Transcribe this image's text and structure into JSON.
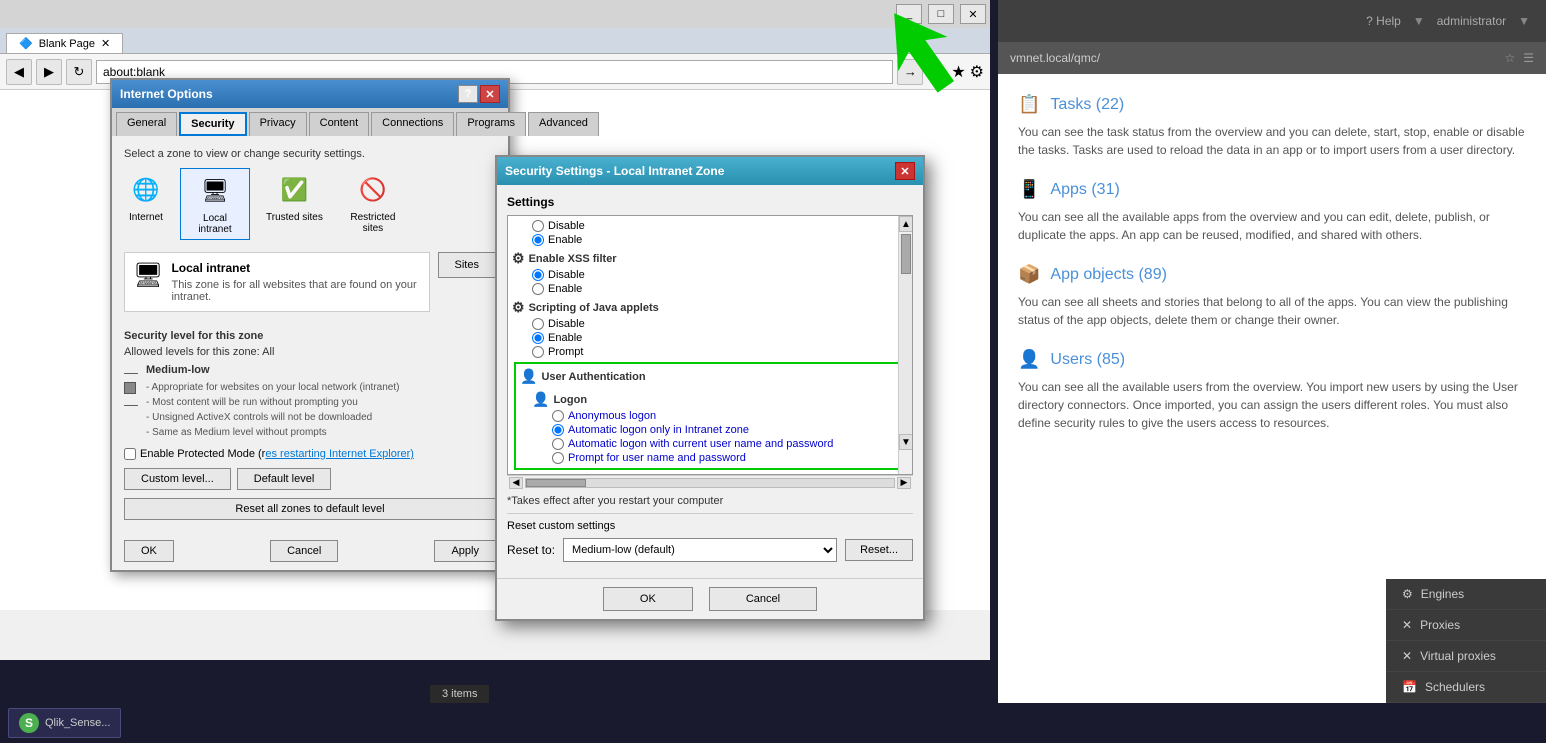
{
  "browser": {
    "title": "Blank Page",
    "title_buttons": [
      "_",
      "□",
      "✕"
    ],
    "address": "about:blank",
    "tab_label": "Blank Page",
    "nav_back": "◀",
    "nav_forward": "▶",
    "nav_refresh": "↻",
    "toolbar_icons": [
      "🏠",
      "★",
      "⚙"
    ]
  },
  "qmc": {
    "url": "vmnet.local/qmc/",
    "help_label": "? Help",
    "user_label": "administrator",
    "sections": [
      {
        "id": "tasks",
        "icon": "📋",
        "title": "Tasks (22)",
        "text": "You can see the task status from the overview and you can delete, start, stop, enable or disable the tasks. Tasks are used to reload the data in an app or to import users from a user directory."
      },
      {
        "id": "apps",
        "icon": "📱",
        "title": "Apps (31)",
        "text": "You can see all the available apps from the overview and you can edit, delete, publish, or duplicate the apps. An app can be reused, modified, and shared with others."
      },
      {
        "id": "app-objects",
        "icon": "📦",
        "title": "App objects (89)",
        "text": "You can see all sheets and stories that belong to all of the apps. You can view the publishing status of the app objects, delete them or change their owner."
      },
      {
        "id": "users",
        "icon": "👤",
        "title": "Users (85)",
        "text": "You can see all the available users from the overview. You import new users by using the User directory connectors. Once imported, you can assign the users different roles. You must also define security rules to give the users access to resources."
      }
    ],
    "sidebar_items": [
      "Engines",
      "Proxies",
      "Virtual proxies",
      "Schedulers"
    ]
  },
  "internet_options": {
    "title": "Internet Options",
    "title_btn_help": "?",
    "title_btn_close": "✕",
    "tabs": [
      "General",
      "Security",
      "Privacy",
      "Content",
      "Connections",
      "Programs",
      "Advanced"
    ],
    "active_tab": "Security",
    "zone_select_label": "Select a zone to view or change security settings.",
    "zones": [
      {
        "id": "internet",
        "label": "Internet",
        "icon": "🌐"
      },
      {
        "id": "local-intranet",
        "label": "Local intranet",
        "icon": "🖥",
        "selected": true
      },
      {
        "id": "trusted-sites",
        "label": "Trusted sites",
        "icon": "✅"
      },
      {
        "id": "restricted-sites",
        "label": "Restricted sites",
        "icon": "🚫"
      }
    ],
    "zone_title": "Local intranet",
    "zone_desc": "This zone is for all websites that are found on your intranet.",
    "sites_btn": "Sites",
    "security_level_label": "Security level for this zone",
    "allowed_label": "Allowed levels for this zone: All",
    "level_name": "Medium-low",
    "level_desc_lines": [
      "- Appropriate for websites on your local network (intranet)",
      "- Most content will be run without prompting you",
      "- Unsigned ActiveX controls will not be downloaded",
      "- Same as Medium level without prompts"
    ],
    "protect_label": "Enable Protected Mode (r",
    "protect_link": "es restarting Internet Explorer)",
    "custom_level_btn": "Custom level...",
    "default_level_btn": "Default level",
    "reset_all_btn": "Reset all zones to default level",
    "ok_btn": "OK",
    "cancel_btn": "Cancel",
    "apply_btn": "Apply"
  },
  "security_settings": {
    "title": "Security Settings - Local Intranet Zone",
    "close_btn": "✕",
    "settings_label": "Settings",
    "items": [
      {
        "id": "item1",
        "label": "",
        "options": [
          {
            "label": "Disable",
            "checked": false
          },
          {
            "label": "Enable",
            "checked": true
          }
        ]
      },
      {
        "id": "xss-filter",
        "label": "Enable XSS filter",
        "icon": "⚙",
        "options": [
          {
            "label": "Disable",
            "checked": true
          },
          {
            "label": "Enable",
            "checked": false
          }
        ]
      },
      {
        "id": "java-scripting",
        "label": "Scripting of Java applets",
        "icon": "⚙",
        "options": [
          {
            "label": "Disable",
            "checked": false
          },
          {
            "label": "Enable",
            "checked": true
          },
          {
            "label": "Prompt",
            "checked": false
          }
        ]
      },
      {
        "id": "user-auth",
        "label": "User Authentication",
        "icon": "👤",
        "highlighted": true,
        "sub_items": [
          {
            "id": "logon",
            "label": "Logon",
            "icon": "👤",
            "options": [
              {
                "label": "Anonymous logon",
                "checked": false
              },
              {
                "label": "Automatic logon only in Intranet zone",
                "checked": true
              },
              {
                "label": "Automatic logon with current user name and password",
                "checked": false
              },
              {
                "label": "Prompt for user name and password",
                "checked": false
              }
            ]
          }
        ]
      }
    ],
    "note": "*Takes effect after you restart your computer",
    "reset_label": "Reset custom settings",
    "reset_to_label": "Reset to:",
    "reset_to_value": "Medium-low (default)",
    "reset_btn": "Reset...",
    "ok_btn": "OK",
    "cancel_btn": "Cancel"
  },
  "taskbar": {
    "items": [
      {
        "label": "Qlik_Sense...",
        "icon": "S"
      }
    ],
    "status": "3 items"
  }
}
